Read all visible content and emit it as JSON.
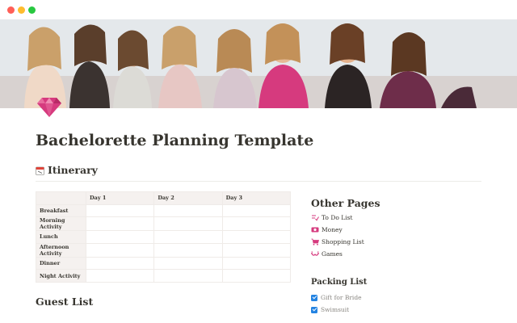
{
  "window": {
    "controls": [
      "close",
      "minimize",
      "zoom"
    ]
  },
  "page": {
    "icon": "gem-icon",
    "title": "Bachelorette Planning Template"
  },
  "itinerary": {
    "heading": "Itinerary",
    "heading_icon": "calendar-icon",
    "columns": [
      "",
      "Day 1",
      "Day 2",
      "Day 3"
    ],
    "rows": [
      "Breakfast",
      "Morning Activity",
      "Lunch",
      "Afternoon Activity",
      "Dinner",
      "Night Activity"
    ]
  },
  "guest_list": {
    "heading": "Guest List"
  },
  "other_pages": {
    "heading": "Other Pages",
    "items": [
      {
        "label": "To Do List",
        "icon": "checklist-icon"
      },
      {
        "label": "Money",
        "icon": "money-icon"
      },
      {
        "label": "Shopping List",
        "icon": "cart-icon"
      },
      {
        "label": "Games",
        "icon": "bra-icon"
      }
    ]
  },
  "packing_list": {
    "heading": "Packing List",
    "items": [
      {
        "label": "Gift for Bride",
        "checked": true
      },
      {
        "label": "Swimsuit",
        "checked": true
      }
    ]
  },
  "colors": {
    "accent_pink": "#d63a7e",
    "checkbox_blue": "#2383e2",
    "table_header_bg": "#f5f1ef",
    "text": "#37352f"
  }
}
